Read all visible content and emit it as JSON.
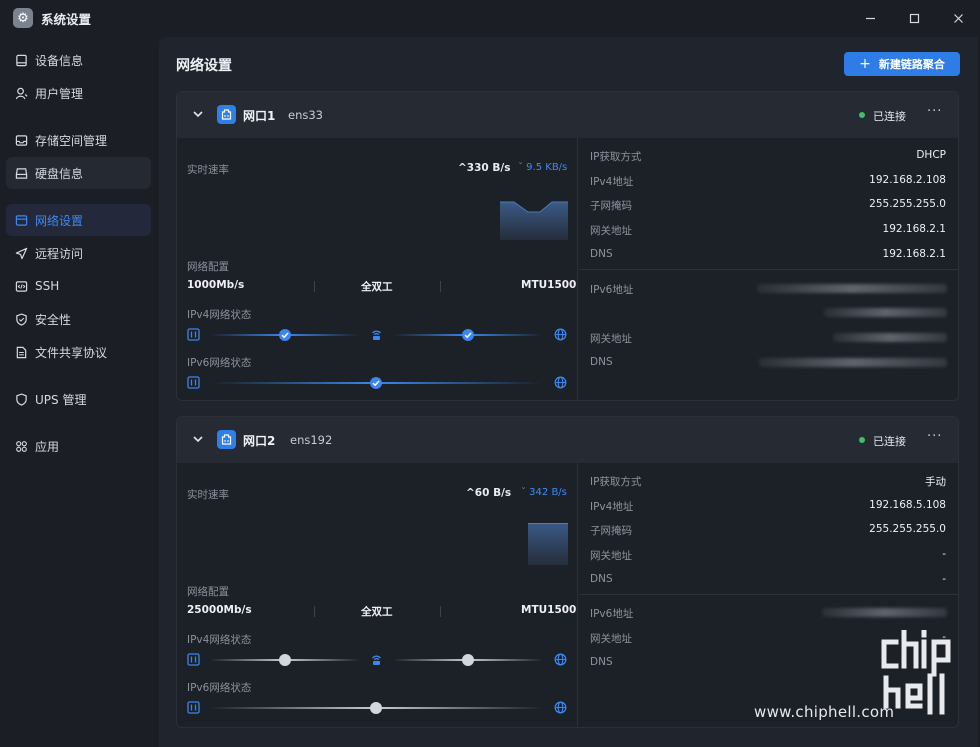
{
  "window": {
    "title": "系统设置",
    "controls": {
      "minimize": "–",
      "maximize": "☐",
      "close": "✕"
    }
  },
  "sidebar": {
    "items": [
      {
        "label": "设备信息",
        "icon": "device-icon"
      },
      {
        "label": "用户管理",
        "icon": "user-icon"
      },
      {
        "label": "存储空间管理",
        "icon": "storage-icon"
      },
      {
        "label": "硬盘信息",
        "icon": "disk-icon"
      },
      {
        "label": "网络设置",
        "icon": "network-icon",
        "active": true
      },
      {
        "label": "远程访问",
        "icon": "send-icon"
      },
      {
        "label": "SSH",
        "icon": "code-icon"
      },
      {
        "label": "安全性",
        "icon": "shield-check-icon"
      },
      {
        "label": "文件共享协议",
        "icon": "file-share-icon"
      },
      {
        "label": "UPS 管理",
        "icon": "shield-icon"
      },
      {
        "label": "应用",
        "icon": "apps-icon"
      }
    ]
  },
  "main": {
    "title": "网络设置",
    "new_button": "新建链路聚合",
    "new_button_icon": "+"
  },
  "ports": [
    {
      "name": "网口1",
      "device": "ens33",
      "status": "已连接",
      "more": "···",
      "speed_label": "实时速率",
      "speed_up": "^330 B/s",
      "speed_down": "ˇ 9.5 KB/s",
      "config_label": "网络配置",
      "link_speed": "1000Mb/s",
      "duplex": "全双工",
      "mtu": "MTU1500",
      "ipv4_state_label": "IPv4网络状态",
      "ipv6_state_label": "IPv6网络状态",
      "ipv4_connected": true,
      "ipv6_connected": true,
      "info": {
        "ip_method_label": "IP获取方式",
        "ip_method": "DHCP",
        "ipv4_label": "IPv4地址",
        "ipv4": "192.168.2.108",
        "mask_label": "子网掩码",
        "mask": "255.255.255.0",
        "gateway_label": "网关地址",
        "gateway": "192.168.2.1",
        "dns_label": "DNS",
        "dns": "192.168.2.1",
        "ipv6_label": "IPv6地址",
        "ipv6_gateway_label": "网关地址",
        "ipv6_dns_label": "DNS"
      }
    },
    {
      "name": "网口2",
      "device": "ens192",
      "status": "已连接",
      "more": "···",
      "speed_label": "实时速率",
      "speed_up": "^60 B/s",
      "speed_down": "ˇ 342 B/s",
      "config_label": "网络配置",
      "link_speed": "25000Mb/s",
      "duplex": "全双工",
      "mtu": "MTU1500",
      "ipv4_state_label": "IPv4网络状态",
      "ipv6_state_label": "IPv6网络状态",
      "ipv4_connected": false,
      "ipv6_connected": false,
      "info": {
        "ip_method_label": "IP获取方式",
        "ip_method": "手动",
        "ipv4_label": "IPv4地址",
        "ipv4": "192.168.5.108",
        "mask_label": "子网掩码",
        "mask": "255.255.255.0",
        "gateway_label": "网关地址",
        "gateway": "-",
        "dns_label": "DNS",
        "dns": "-",
        "ipv6_label": "IPv6地址",
        "ipv6_gateway_label": "网关地址",
        "ipv6_gateway": "-",
        "ipv6_dns_label": "DNS"
      }
    }
  ],
  "watermark": {
    "text": "www.chiphell.com",
    "logo": "chip hell"
  },
  "colors": {
    "accent": "#2e7ce6",
    "connected": "#3fbf6a",
    "bg": "#1b1e25"
  }
}
